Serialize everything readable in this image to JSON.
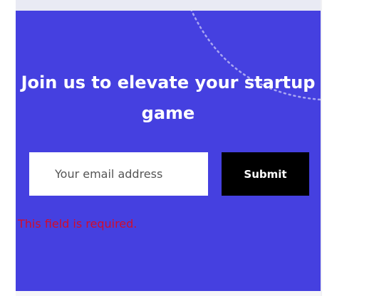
{
  "newsletter": {
    "heading": "Join us to elevate your startup game",
    "email_placeholder": "Your email address",
    "submit_label": "Submit",
    "error_message": "This field is required."
  },
  "colors": {
    "panel_background": "#4540e0",
    "button_background": "#000000",
    "error_text": "#d20b2b"
  }
}
